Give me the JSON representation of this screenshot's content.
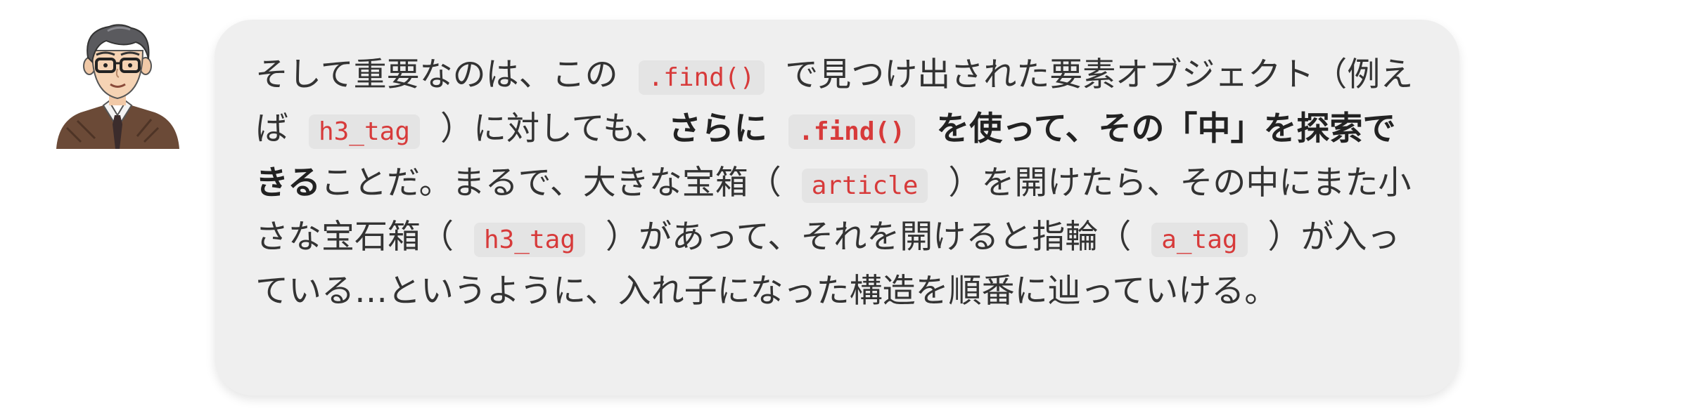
{
  "message": {
    "p1": "そして重要なのは、この ",
    "code1": ".find()",
    "p2": " で見つけ出された要素オブジェクト（例えば ",
    "code2": "h3_tag",
    "p3": " ）に対しても、",
    "bold1": "さらに ",
    "code3": ".find()",
    "bold2": " を使って、その「中」を探索できる",
    "p4": "ことだ。まるで、大きな宝箱（ ",
    "code4": "article",
    "p5": " ）を開けたら、その中にまた小さな宝石箱（ ",
    "code5": "h3_tag",
    "p6": " ）があって、それを開けると指輪（ ",
    "code6": "a_tag",
    "p7": " ）が入っている…というように、入れ子になった構造を順番に辿っていける。"
  },
  "colors": {
    "bubble": "#efefef",
    "code_text": "#d73a3a",
    "code_bg": "#e4e4e4",
    "body_text": "#333333"
  }
}
